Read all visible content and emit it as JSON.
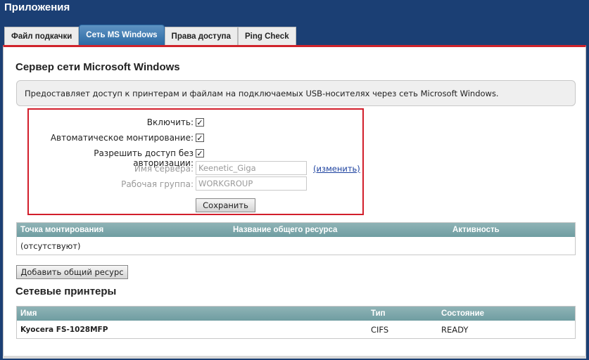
{
  "app": {
    "title": "Приложения"
  },
  "tabs": [
    {
      "label": "Файл подкачки"
    },
    {
      "label": "Сеть MS Windows"
    },
    {
      "label": "Права доступа"
    },
    {
      "label": "Ping Check"
    }
  ],
  "server_section": {
    "title": "Сервер сети Microsoft Windows",
    "description": "Предоставляет доступ к принтерам и файлам на подключаемых USB-носителях через сеть Microsoft Windows.",
    "enable_label": "Включить:",
    "enable_checked": "✓",
    "automount_label": "Автоматическое монтирование:",
    "automount_checked": "✓",
    "anon_label": "Разрешить доступ без авторизации:",
    "anon_checked": "✓",
    "server_name_label": "Имя сервера:",
    "server_name_value": "Keenetic_Giga",
    "change_link": "(изменить)",
    "workgroup_label": "Рабочая группа:",
    "workgroup_value": "WORKGROUP",
    "save_label": "Сохранить"
  },
  "shares_table": {
    "headers": [
      "Точка монтирования",
      "Название общего ресурса",
      "Активность"
    ],
    "empty_text": "(отсутствуют)",
    "add_label": "Добавить общий ресурс"
  },
  "printers_section": {
    "title": "Сетевые принтеры",
    "headers": [
      "Имя",
      "Тип",
      "Состояние"
    ],
    "rows": [
      {
        "name": "Kyocera FS-1028MFP",
        "type": "CIFS",
        "status": "READY"
      }
    ]
  }
}
